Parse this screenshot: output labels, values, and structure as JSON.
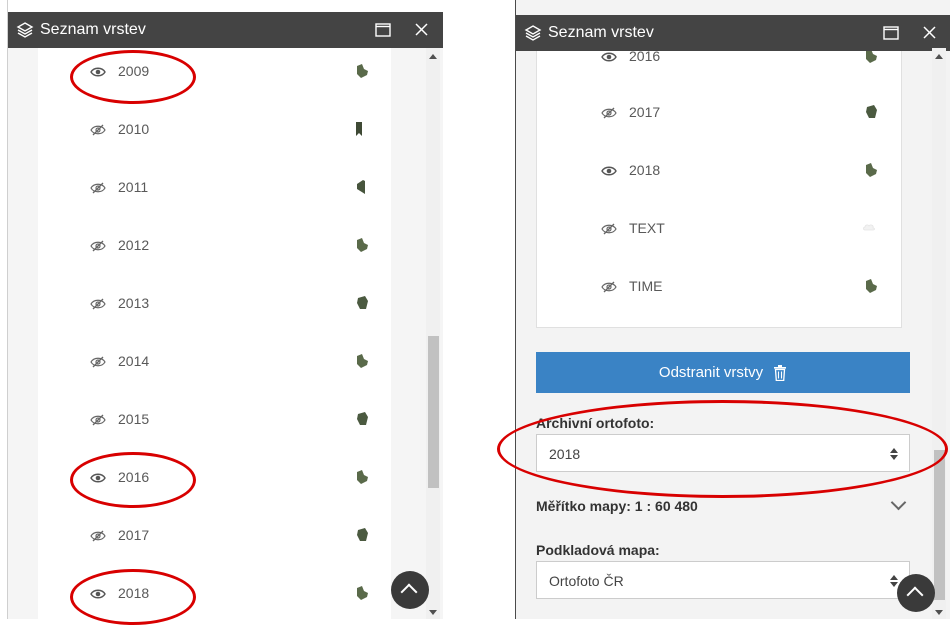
{
  "left": {
    "title": "Seznam vrstev",
    "rows": [
      {
        "label": "2009",
        "visible": true
      },
      {
        "label": "2010",
        "visible": false
      },
      {
        "label": "2011",
        "visible": false
      },
      {
        "label": "2012",
        "visible": false
      },
      {
        "label": "2013",
        "visible": false
      },
      {
        "label": "2014",
        "visible": false
      },
      {
        "label": "2015",
        "visible": false
      },
      {
        "label": "2016",
        "visible": true
      },
      {
        "label": "2017",
        "visible": false
      },
      {
        "label": "2018",
        "visible": true
      }
    ]
  },
  "right": {
    "title": "Seznam vrstev",
    "rows": [
      {
        "label": "2016",
        "visible": true
      },
      {
        "label": "2017",
        "visible": false
      },
      {
        "label": "2018",
        "visible": true
      },
      {
        "label": "TEXT",
        "visible": false
      },
      {
        "label": "TIME",
        "visible": false
      }
    ],
    "remove_label": "Odstranit vrstvy",
    "archive_label": "Archivní ortofoto:",
    "archive_value": "2018",
    "scale_label": "Měřítko mapy: 1 : 60 480",
    "basemap_label": "Podkladová mapa:",
    "basemap_value": "Ortofoto ČR"
  },
  "colors": {
    "titlebar": "#444444",
    "accent_button": "#3a83c5",
    "highlight": "#d80000"
  }
}
